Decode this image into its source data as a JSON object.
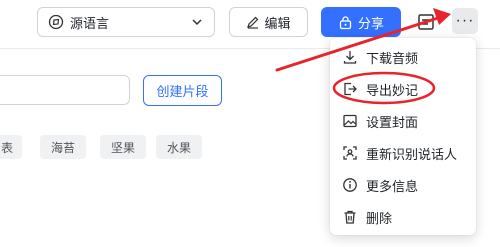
{
  "toolbar": {
    "language_select": {
      "value": "源语言",
      "icon": "globe-icon"
    },
    "edit_label": "编辑",
    "share_label": "分享",
    "more_label": "···"
  },
  "clip": {
    "input_value": "",
    "create_label": "创建片段"
  },
  "tags": [
    {
      "label": "表"
    },
    {
      "label": "海苔"
    },
    {
      "label": "坚果"
    },
    {
      "label": "水果"
    }
  ],
  "more_menu": {
    "items": [
      {
        "label": "下载音频",
        "icon": "download-icon"
      },
      {
        "label": "导出妙记",
        "icon": "export-icon"
      },
      {
        "label": "设置封面",
        "icon": "image-icon"
      },
      {
        "label": "重新识别说话人",
        "icon": "scan-icon"
      },
      {
        "label": "更多信息",
        "icon": "info-icon"
      },
      {
        "label": "删除",
        "icon": "trash-icon"
      }
    ]
  },
  "colors": {
    "accent": "#3370ff",
    "annotation": "#e8232b"
  }
}
